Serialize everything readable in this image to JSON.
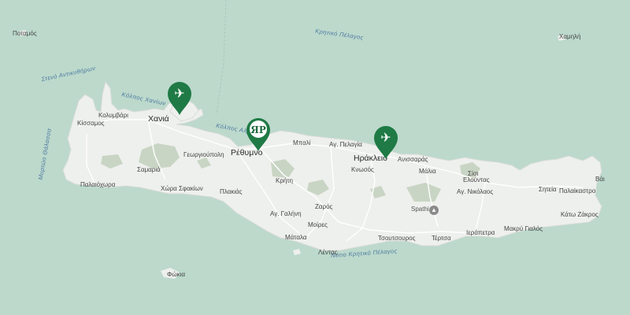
{
  "map": {
    "colors": {
      "sea": "#bcd9cc",
      "land": "#eef0ed",
      "roads": "#ffffff",
      "relief": "#c2cfbf",
      "marker": "#1f7a45",
      "sea_text": "#4d78a0"
    },
    "seas": {
      "cretan_sea": "Κρητικό Πέλαγος",
      "antikythira_strait": "Στενό Αντικυθήρων",
      "chania_gulf": "Κόλπος Χανίων",
      "almyros_gulf": "Κόλπος Αλμυ",
      "libyan_sea": "Νότιο Κρητικό Πέλαγος",
      "myrtoan_sea": "Μυρτώο Θάλασσα"
    },
    "places": {
      "chania": "Χανιά",
      "rethymno": "Ρέθυμνο",
      "heraklion": "Ηράκλειο",
      "kissamos": "Κίσσαμος",
      "kolymvari": "Κολυμβάρι",
      "georgioupoli": "Γεωργιούπολη",
      "samaria": "Σαμαριά",
      "paleochora": "Παλαιόχωρα",
      "chora_sfakion": "Χώρα Σφακίων",
      "plakias": "Πλακιάς",
      "kriti": "Κρήτη",
      "zaros": "Ζαρός",
      "ag_galini": "Αγ. Γαλήνη",
      "moires": "Μοίρες",
      "matala": "Μάταλα",
      "lentas": "Λέντας",
      "bali": "Μπαλί",
      "ag_pelagia": "Αγ. Πελαγία",
      "knosos": "Κνωσός",
      "anissaras": "Ανισσαράς",
      "malia": "Μάλια",
      "sisi": "Σίσι",
      "elounda": "Ελούντας",
      "ag_nikolaos": "Αγ. Νικόλαος",
      "sitia": "Σητεία",
      "palaikastro": "Παλαίκαστρο",
      "vai": "Βάι",
      "kato_zakros": "Κάτω Ζάκρος",
      "makry_gialos": "Μακρύ Γιαλός",
      "ierapetra": "Ιεράπετρα",
      "tertsa": "Τέρτσα",
      "tsoutsouros": "Τσουτσουρος",
      "spathi": "Spathi",
      "potamos": "Ποταμός",
      "chamili": "Χαμηλή",
      "fokia": "Φώκια"
    },
    "markers": [
      {
        "type": "airport",
        "icon": "airplane-icon",
        "glyph": "✈"
      },
      {
        "type": "hotel",
        "icon": "hotel-logo-icon",
        "glyph": "ЯP"
      },
      {
        "type": "airport",
        "icon": "airplane-icon",
        "glyph": "✈"
      }
    ]
  }
}
